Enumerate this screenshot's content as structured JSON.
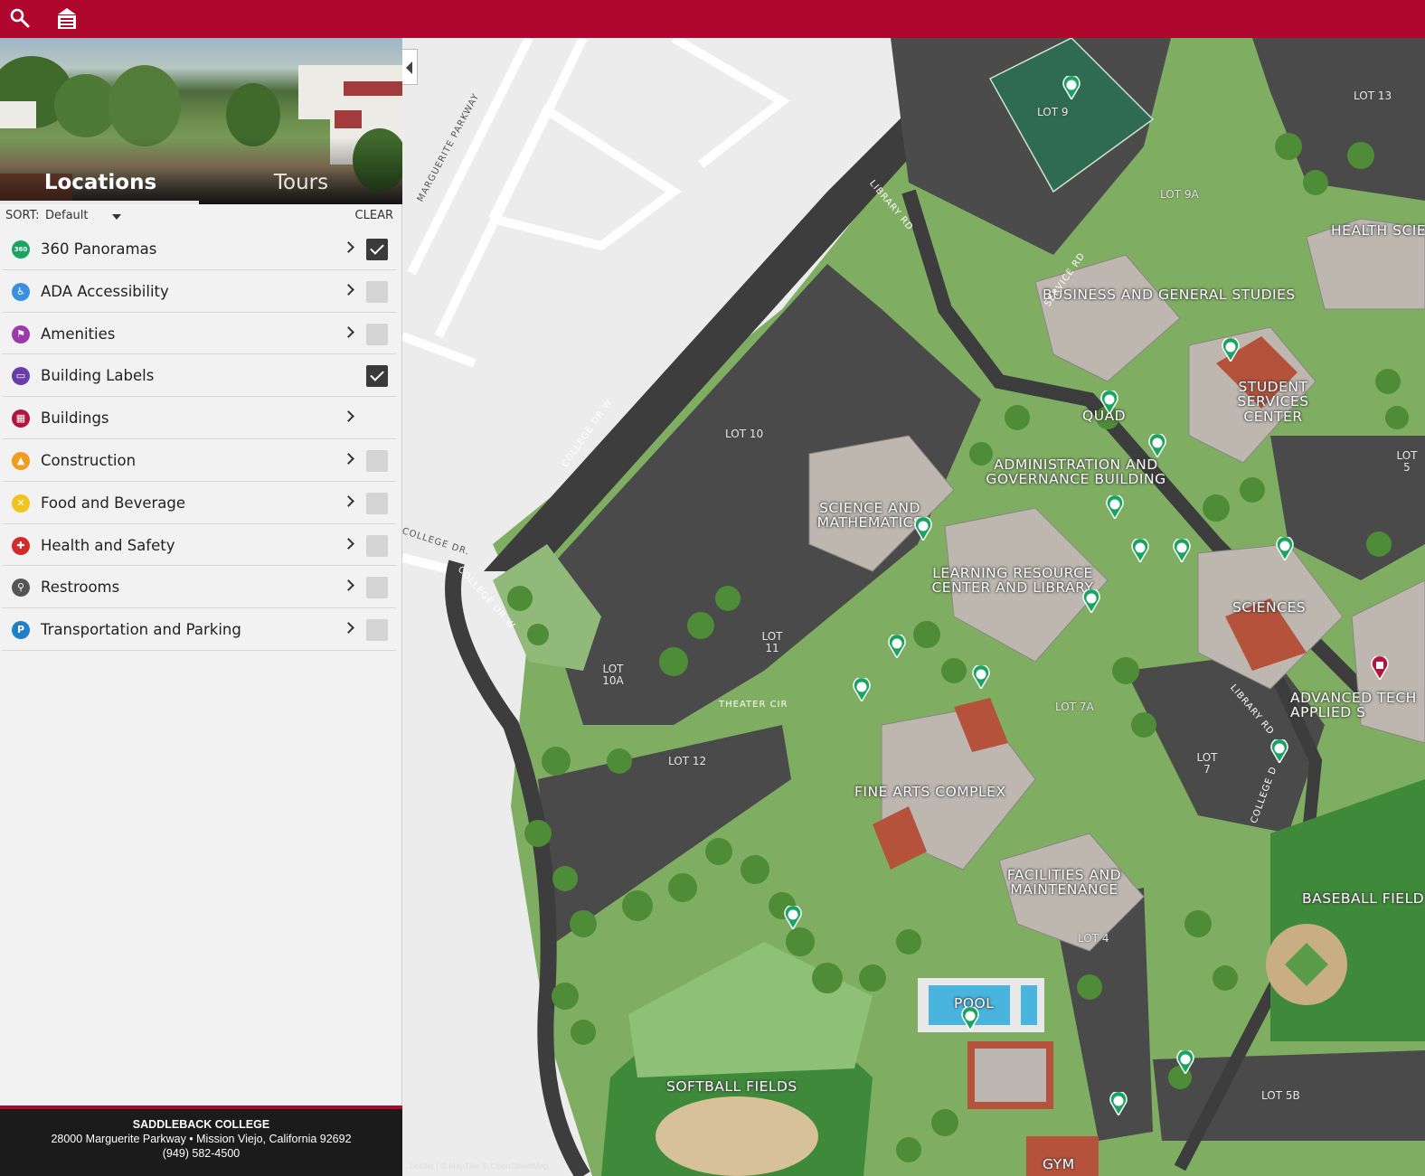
{
  "sidebar": {
    "tabs": [
      {
        "label": "Locations"
      },
      {
        "label": "Tours"
      }
    ],
    "sort": {
      "label": "SORT:",
      "value": "Default",
      "clear": "CLEAR"
    },
    "categories": [
      {
        "label": "360 Panoramas",
        "icon": "panorama-360-icon",
        "color": "#19a461",
        "icon_text": "360",
        "chevron": true,
        "checked": true
      },
      {
        "label": "ADA Accessibility",
        "icon": "wheelchair-icon",
        "color": "#3b8fe0",
        "icon_text": "♿",
        "chevron": true,
        "checked": false
      },
      {
        "label": "Amenities",
        "icon": "flag-icon",
        "color": "#9b3aa8",
        "icon_text": "⚑",
        "chevron": true,
        "checked": false
      },
      {
        "label": "Building Labels",
        "icon": "label-icon",
        "color": "#6b3da8",
        "icon_text": "▭",
        "chevron": false,
        "checked": true
      },
      {
        "label": "Buildings",
        "icon": "building-icon",
        "color": "#b0163d",
        "icon_text": "▦",
        "chevron": true,
        "checked": null
      },
      {
        "label": "Construction",
        "icon": "construction-icon",
        "color": "#f09c1d",
        "icon_text": "▲",
        "chevron": true,
        "checked": false
      },
      {
        "label": "Food and Beverage",
        "icon": "food-icon",
        "color": "#f0c41d",
        "icon_text": "✕",
        "chevron": true,
        "checked": false
      },
      {
        "label": "Health and Safety",
        "icon": "health-cross-icon",
        "color": "#d42a2a",
        "icon_text": "✚",
        "chevron": true,
        "checked": false
      },
      {
        "label": "Restrooms",
        "icon": "restroom-icon",
        "color": "#555555",
        "icon_text": "⚲",
        "chevron": true,
        "checked": false
      },
      {
        "label": "Transportation and Parking",
        "icon": "parking-icon",
        "color": "#1f7fc9",
        "icon_text": "P",
        "chevron": true,
        "checked": false
      }
    ]
  },
  "footer": {
    "name": "SADDLEBACK COLLEGE",
    "address": "28000 Marguerite Parkway • Mission Viejo, California 92692",
    "phone": "(949) 582-4500"
  },
  "map": {
    "attribution": "Leaflet | © MapTiler © OpenStreetMap",
    "buildings": [
      "HEALTH SCIENCES",
      "BUSINESS AND GENERAL STUDIES",
      "STUDENT SERVICES CENTER",
      "QUAD",
      "ADMINISTRATION AND GOVERNANCE BUILDING",
      "SCIENCE AND MATHEMATICS",
      "LEARNING RESOURCE CENTER AND LIBRARY",
      "SCIENCES",
      "ADVANCED TECH APPLIED S",
      "FINE ARTS COMPLEX",
      "FACILITIES AND MAINTENANCE",
      "BASEBALL FIELD",
      "POOL",
      "SOFTBALL FIELDS",
      "GYM"
    ],
    "lots": [
      "LOT 9",
      "LOT 13",
      "LOT 9A",
      "LOT 10",
      "LOT 11",
      "LOT 10A",
      "LOT 12",
      "LOT 7A",
      "LOT 7",
      "LOT 4",
      "LOT 5B",
      "LOT 5"
    ],
    "roads": [
      "LIBRARY RD",
      "SERVICE RD",
      "COLLEGE DR W",
      "COLLEGE DR.",
      "THEATER CIR",
      "COLLEGE D",
      "MARGUERITE PARKWAY"
    ]
  }
}
